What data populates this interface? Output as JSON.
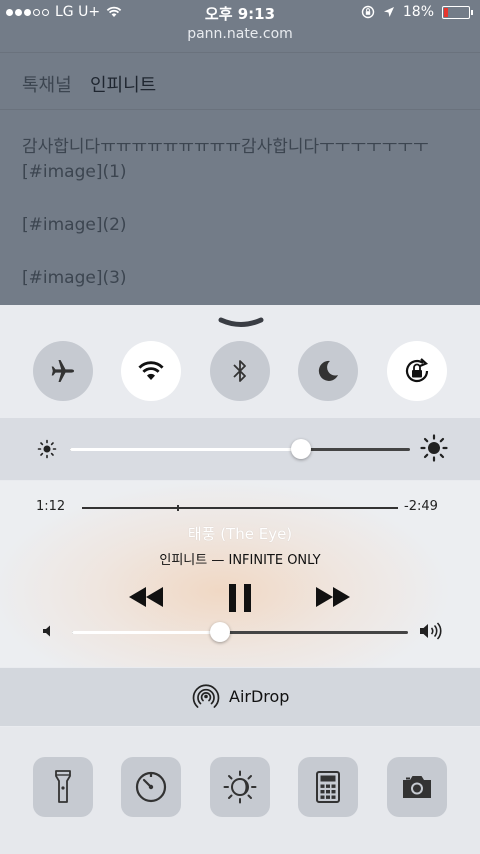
{
  "status_bar": {
    "carrier": "LG U+",
    "time": "오후 9:13",
    "battery": "18%"
  },
  "page": {
    "url": "pann.nate.com",
    "tabs": [
      "톡채널",
      "인피니트"
    ],
    "lines": [
      "감사합니다ㅠㅠㅠㅠㅠㅠㅠㅠㅠ감사합니다ㅜㅜㅜㅜㅜㅜㅜ",
      "[#image](1)",
      "[#image](2)",
      "[#image](3)"
    ]
  },
  "control_center": {
    "toggles": [
      {
        "name": "airplane-mode",
        "on": false
      },
      {
        "name": "wifi",
        "on": true
      },
      {
        "name": "bluetooth",
        "on": false
      },
      {
        "name": "do-not-disturb",
        "on": false
      },
      {
        "name": "rotation-lock",
        "on": true
      }
    ],
    "brightness_level": 0.68,
    "music": {
      "elapsed": "1:12",
      "remaining": "-2:49",
      "progress": 0.3,
      "title": "태풍 (The Eye)",
      "artist_album": "인피니트 — INFINITE ONLY",
      "volume_level": 0.44
    },
    "airdrop_label": "AirDrop",
    "shortcuts": [
      "flashlight",
      "timer",
      "night-shift",
      "calculator",
      "camera"
    ]
  }
}
